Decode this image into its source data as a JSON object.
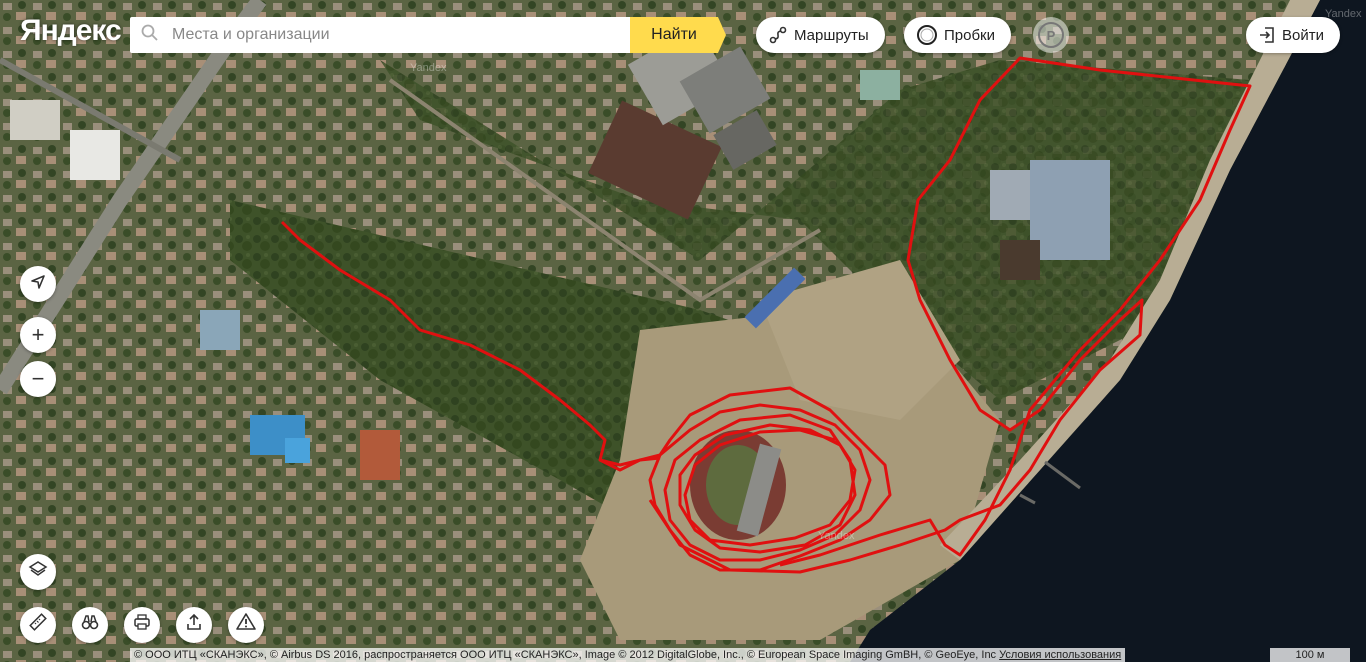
{
  "header": {
    "logo": "Яндекс",
    "search": {
      "placeholder": "Места и организации",
      "value": "",
      "button_label": "Найти"
    },
    "routes_label": "Маршруты",
    "traffic_label": "Пробки",
    "parking_label": "P",
    "login_label": "Войти"
  },
  "map": {
    "type": "satellite",
    "route_color": "#e01010",
    "water_color": "#0e1620",
    "watermark": "Yandex"
  },
  "controls": {
    "locate_icon": "navigation-arrow-icon",
    "zoom_in": "+",
    "zoom_out": "−",
    "layers_icon": "layers-icon",
    "ruler_icon": "ruler-icon",
    "panorama_icon": "binoculars-icon",
    "print_icon": "printer-icon",
    "share_icon": "share-icon",
    "report_icon": "warning-icon"
  },
  "footer": {
    "copyright": "© ООО ИТЦ «СКАНЭКС», © Airbus DS 2016, распространяется ООО ИТЦ «СКАНЭКС», Image © 2012 DigitalGlobe, Inc., © European Space Imaging GmBH, © GeoEye, Inc",
    "terms_link": "Условия использования",
    "scale_label": "100 м"
  }
}
